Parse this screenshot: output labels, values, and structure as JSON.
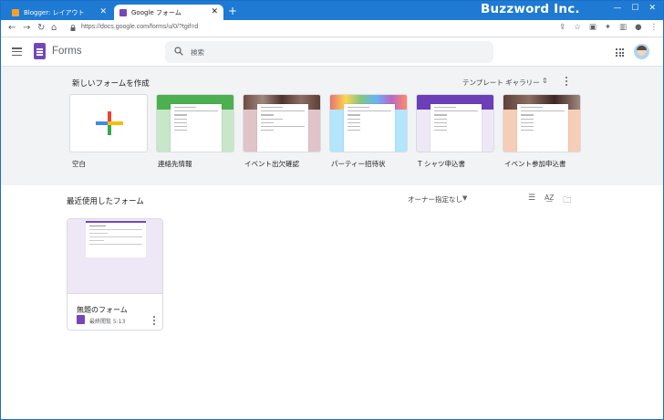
{
  "browser": {
    "tabs": [
      {
        "title": "Blogger: レイアウト",
        "favicon_color": "#f4a12c"
      },
      {
        "title": "Google フォーム",
        "favicon_color": "#7248b9"
      }
    ],
    "new_tab": "+",
    "brand": "Buzzword Inc.",
    "window_controls": {
      "minimize": "—",
      "maximize": "☐",
      "close": "✕"
    },
    "url": "https://docs.google.com/forms/u/0/?tgif=d"
  },
  "app": {
    "name": "Forms",
    "search_placeholder": "検索",
    "accent_color": "#7248b9"
  },
  "templates": {
    "section_title": "新しいフォームを作成",
    "gallery_label": "テンプレート ギャラリー",
    "items": [
      {
        "label": "空白"
      },
      {
        "label": "連絡先情報"
      },
      {
        "label": "イベント出欠確認"
      },
      {
        "label": "パーティー招待状"
      },
      {
        "label": "T シャツ申込書"
      },
      {
        "label": "イベント参加申込書"
      }
    ]
  },
  "recent": {
    "title": "最近使用したフォーム",
    "owner_filter": "オーナー指定なし",
    "forms": [
      {
        "name": "無題のフォーム",
        "meta": "最終閲覧 5:13"
      }
    ]
  }
}
